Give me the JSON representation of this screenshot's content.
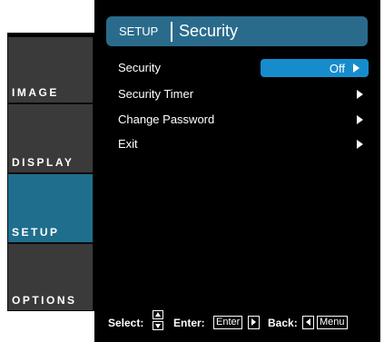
{
  "tabs": [
    {
      "label": "IMAGE",
      "active": false
    },
    {
      "label": "DISPLAY",
      "active": false
    },
    {
      "label": "SETUP",
      "active": true
    },
    {
      "label": "OPTIONS",
      "active": false
    }
  ],
  "header": {
    "section": "SETUP",
    "title": "Security"
  },
  "menu": [
    {
      "label": "Security",
      "value": "Off"
    },
    {
      "label": "Security Timer"
    },
    {
      "label": "Change Password"
    },
    {
      "label": "Exit"
    }
  ],
  "footer": {
    "select_label": "Select:",
    "enter_label": "Enter:",
    "enter_key": "Enter",
    "back_label": "Back:",
    "menu_key": "Menu"
  },
  "colors": {
    "accent": "#178ccd",
    "header": "#2a6b8c",
    "active_tab": "#1f6e8d",
    "tab": "#3a3a3a"
  }
}
